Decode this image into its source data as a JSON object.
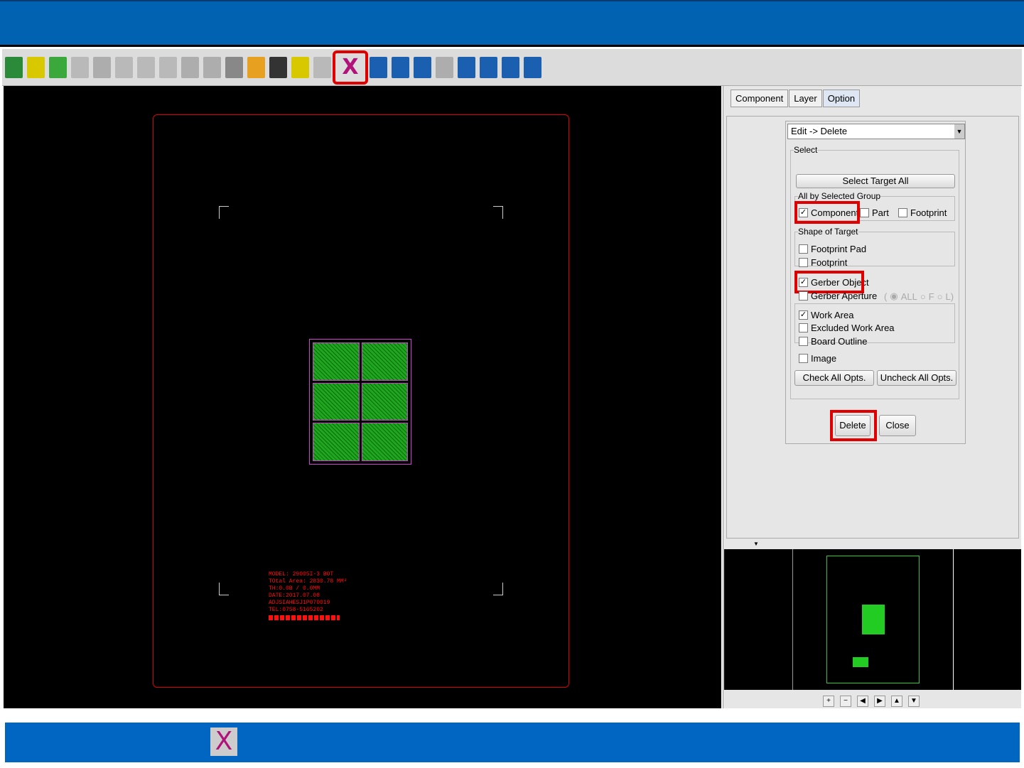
{
  "toolbar": {
    "icons": [
      "line-tool-icon",
      "origin-icon",
      "component-icon",
      "m-icon",
      "chip-icon",
      "array-icon",
      "array2-icon",
      "hand-icon",
      "ic-icon",
      "ic2-icon",
      "grid-icon",
      "import-icon",
      "target-icon",
      "drill-icon",
      "m2-icon",
      "delete-icon",
      "move-icon",
      "rotate-icon",
      "mirror-icon",
      "copy-icon",
      "rotate-all-icon",
      "rotate-all2-icon",
      "x-align-all-icon",
      "y-align-all-icon"
    ],
    "delete_glyph": "X"
  },
  "board": {
    "info_lines": [
      "MODEL: 29005I-3 BOT",
      "TOtal Area: 2830.78 MM²",
      "TH:0.0B / 0.0MM",
      "DATE:2017.07.08",
      "ADJSIAHESJ1P070019",
      "TEL:0758-5165202"
    ]
  },
  "panel": {
    "tabs": [
      {
        "label": "Component"
      },
      {
        "label": "Layer"
      },
      {
        "label": "Option"
      }
    ],
    "mode": "Edit -> Delete",
    "select_legend": "Select",
    "select_target_all": "Select Target All",
    "group_legend": "All by Selected Group",
    "group": [
      {
        "label": "Component",
        "checked": true
      },
      {
        "label": "Part",
        "checked": false
      },
      {
        "label": "Footprint",
        "checked": false
      }
    ],
    "shape_legend": "Shape of Target",
    "shape": [
      {
        "label": "Footprint Pad",
        "checked": false
      },
      {
        "label": "Footprint",
        "checked": false
      }
    ],
    "gerber_object": {
      "label": "Gerber Object",
      "checked": true
    },
    "gerber_aperture": {
      "label": "Gerber Aperture",
      "checked": false
    },
    "aperture_opts": [
      "(",
      "ALL",
      "F",
      "L)"
    ],
    "area": [
      {
        "label": "Work Area",
        "checked": true
      },
      {
        "label": "Excluded Work Area",
        "checked": false
      },
      {
        "label": "Board Outline",
        "checked": false
      }
    ],
    "image": {
      "label": "Image",
      "checked": false
    },
    "check_all": "Check All Opts.",
    "uncheck_all": "Uncheck All Opts.",
    "delete": "Delete",
    "close": "Close"
  },
  "nav": [
    "+",
    "−",
    "◀",
    "▶",
    "▲",
    "▼"
  ],
  "footer": {
    "delete_glyph": "X"
  },
  "colors": {
    "accent": "#0062b1",
    "highlight": "#e00000",
    "gerber": "#1fa81f"
  }
}
